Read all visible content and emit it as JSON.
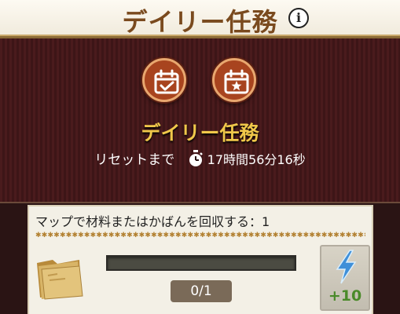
{
  "header": {
    "title": "デイリー任務",
    "info_icon": "info-icon"
  },
  "tabs": [
    {
      "icon": "calendar-check-icon",
      "active": true
    },
    {
      "icon": "calendar-star-icon",
      "active": false
    }
  ],
  "panel": {
    "title": "デイリー任務",
    "reset_label": "リセットまで",
    "reset_time": "17時間56分16秒",
    "timer_icon": "stopwatch-icon"
  },
  "quest": {
    "description": "マップで材料またはかばんを回収する：1",
    "progress_text": "0/1",
    "progress_fraction": 0,
    "item_icon": "folder-icon",
    "reward_icon": "lightning-icon",
    "reward_value": "+10"
  },
  "colors": {
    "header_title": "#7a4a1e",
    "panel_title": "#f0c84a",
    "reward_value": "#4a8a2a",
    "tab_button": "#a8441f"
  }
}
